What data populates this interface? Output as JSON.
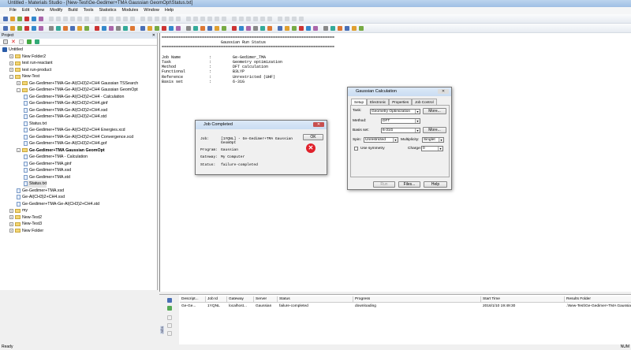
{
  "window": {
    "title": "Untitled - Materials Studio - [New-Test\\Ge-Gedimer+TMA Gaussian GeomOpt\\Status.txt]"
  },
  "menu": [
    "File",
    "Edit",
    "View",
    "Modify",
    "Build",
    "Tools",
    "Statistics",
    "Modules",
    "Window",
    "Help"
  ],
  "project": {
    "title": "Project",
    "items": [
      {
        "label": "Untitled",
        "level": 0,
        "type": "root"
      },
      {
        "label": "New Folder2",
        "level": 1,
        "type": "folder",
        "exp": "+"
      },
      {
        "label": "test run-reactant",
        "level": 1,
        "type": "folder",
        "exp": "+"
      },
      {
        "label": "test run-product",
        "level": 1,
        "type": "folder",
        "exp": "+"
      },
      {
        "label": "New-Test",
        "level": 1,
        "type": "folder",
        "exp": "-"
      },
      {
        "label": "Ge-Gedimer+TMA-Ge-Al(CH3)2+CH4 Gaussian TSSearch",
        "level": 2,
        "type": "folder",
        "exp": "+"
      },
      {
        "label": "Ge-Gedimer+TMA-Ge-Al(CH3)2+CH4 Gaussian GeomOpt",
        "level": 2,
        "type": "folder",
        "exp": "-"
      },
      {
        "label": "Ge-Gedimer+TMA-Ge-Al(CH3)2+CH4 - Calculation",
        "level": 3,
        "type": "file"
      },
      {
        "label": "Ge-Gedimer+TMA-Ge-Al(CH3)2+CH4.ginf",
        "level": 3,
        "type": "file"
      },
      {
        "label": "Ge-Gedimer+TMA-Ge-Al(CH3)2+CH4.xsd",
        "level": 3,
        "type": "file"
      },
      {
        "label": "Ge-Gedimer+TMA-Ge-Al(CH3)2+CH4.std",
        "level": 3,
        "type": "file"
      },
      {
        "label": "Status.txt",
        "level": 3,
        "type": "file"
      },
      {
        "label": "Ge-Gedimer+TMA-Ge-Al(CH3)2+CH4 Energies.xcd",
        "level": 3,
        "type": "file"
      },
      {
        "label": "Ge-Gedimer+TMA-Ge-Al(CH3)2+CH4 Convergence.xcd",
        "level": 3,
        "type": "file"
      },
      {
        "label": "Ge-Gedimer+TMA-Ge-Al(CH3)2+CH4.gof",
        "level": 3,
        "type": "file"
      },
      {
        "label": "Ge-Gedimer+TMA Gaussian GeomOpt",
        "level": 2,
        "type": "folder",
        "exp": "-",
        "bold": true
      },
      {
        "label": "Ge-Gedimer+TMA - Calculation",
        "level": 3,
        "type": "file"
      },
      {
        "label": "Ge-Gedimer+TMA.ginf",
        "level": 3,
        "type": "file"
      },
      {
        "label": "Ge-Gedimer+TMA.xsd",
        "level": 3,
        "type": "file"
      },
      {
        "label": "Ge-Gedimer+TMA.std",
        "level": 3,
        "type": "file"
      },
      {
        "label": "Status.txt",
        "level": 3,
        "type": "file",
        "selected": true
      },
      {
        "label": "Ge-Gedimer+TMA.xsd",
        "level": 2,
        "type": "file"
      },
      {
        "label": "Ge-Al(CH3)2+CH4.xsd",
        "level": 2,
        "type": "file"
      },
      {
        "label": "Ge-Gedimer+TMA-Ge-Al(CH3)2+CH4.std",
        "level": 2,
        "type": "file"
      },
      {
        "label": "my",
        "level": 1,
        "type": "folder",
        "exp": "+"
      },
      {
        "label": "New-Test2",
        "level": 1,
        "type": "folder",
        "exp": "+"
      },
      {
        "label": "New-Test3",
        "level": 1,
        "type": "folder",
        "exp": "+"
      },
      {
        "label": "New Folder",
        "level": 1,
        "type": "folder",
        "exp": "+"
      }
    ]
  },
  "status_doc": {
    "text": "=========================================================================\n                         Gaussian Run Status\n=========================================================================\n\nJob Name            :         Ge-Gedimer_TMA\nTask                :         Geometry optimization\nMethod              :         DFT calculation\nFunctional          :         B3LYP\nReference           :         Unrestricted (UHF)\nBasis set           :         6-31G"
  },
  "job_dialog": {
    "title": "Job Completed",
    "ok": "OK",
    "rows": [
      {
        "k": "Job:",
        "v": "[1YQNL] - Ge-Gedimer+TMA Gaussian GeomOpt"
      },
      {
        "k": "Program:",
        "v": "Gaussian"
      },
      {
        "k": "Gateway:",
        "v": "My Computer"
      },
      {
        "k": "Status:",
        "v": "failure-completed"
      }
    ]
  },
  "gauss_dialog": {
    "title": "Gaussian Calculation",
    "tabs": [
      "Setup",
      "Electronic",
      "Properties",
      "Job Control"
    ],
    "task_label": "Task:",
    "task": "Geometry Optimization",
    "more": "More...",
    "method_label": "Method:",
    "method": "DFT",
    "basis_label": "Basis set:",
    "basis": "6-31G",
    "spin_label": "Spin:",
    "spin": "Unrestricted",
    "mult_label": "Multiplicity:",
    "mult": "Singlet",
    "sym_label": "Use symmetry",
    "charge_label": "Charge:",
    "charge": "0",
    "run": "Run",
    "files": "Files...",
    "help": "Help"
  },
  "jobs": {
    "side_label": "Jobs",
    "columns": [
      "Descript...",
      "Job Id",
      "Gateway",
      "Server",
      "Status",
      "Progress",
      "Start Time",
      "Results Folder"
    ],
    "row": [
      "Ge-Ge...",
      "1YQNL",
      "localhost...",
      "Gaussian",
      "failure-completed",
      "downloading",
      "2016/1/10 19:49:30",
      ".\\New-Test\\Ge-Gedimer+TMA Gaussian G..."
    ]
  },
  "statusbar": {
    "left": "Ready",
    "num": "NUM"
  }
}
